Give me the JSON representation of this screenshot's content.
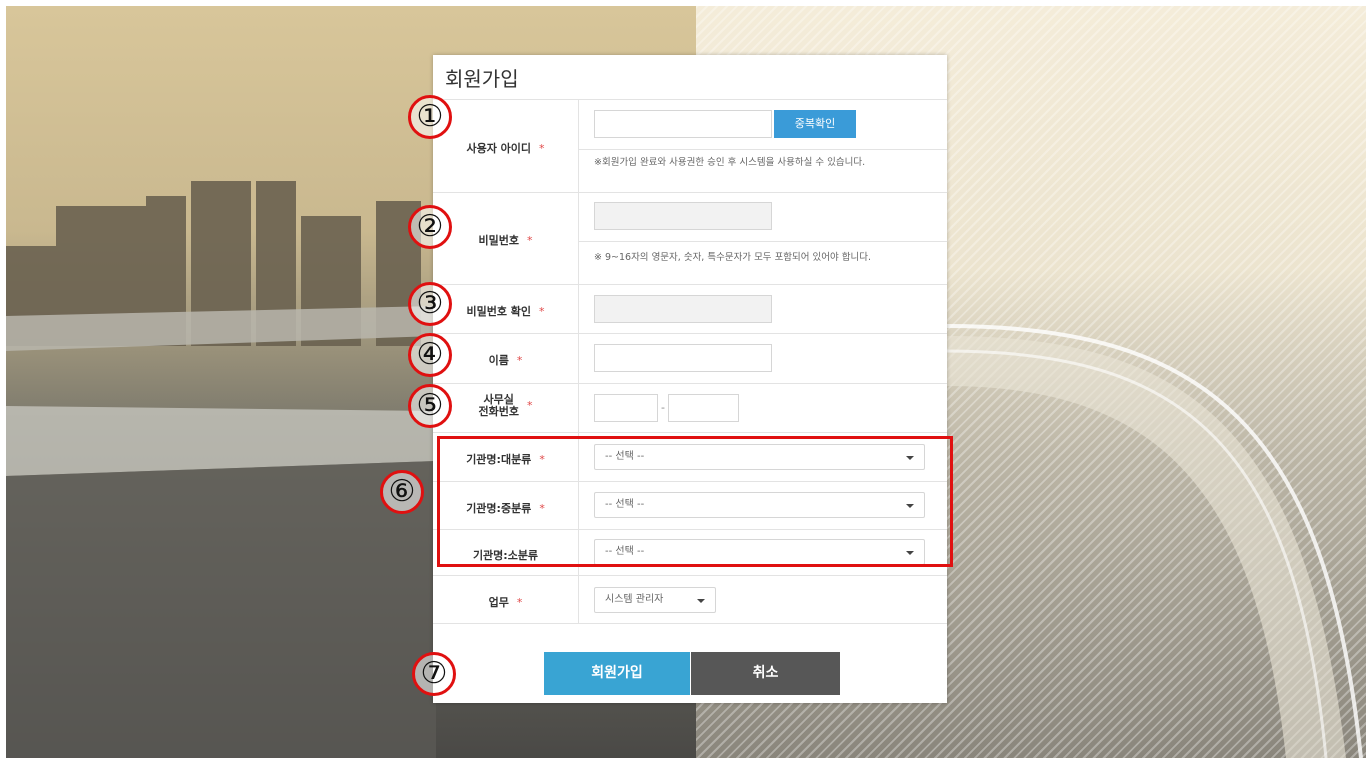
{
  "form": {
    "title": "회원가입",
    "user_id": {
      "label": "사용자 아이디",
      "required": "*",
      "value": "",
      "check_button": "중복확인",
      "hint": "※회원가입 완료와 사용권한 승인 후 시스템을 사용하실 수 있습니다."
    },
    "password": {
      "label": "비밀번호",
      "required": "*",
      "value": "",
      "hint": "※ 9~16자의 영문자, 숫자, 특수문자가 모두 포함되어 있어야 합니다."
    },
    "password_confirm": {
      "label": "비밀번호 확인",
      "required": "*",
      "value": ""
    },
    "name": {
      "label": "이름",
      "required": "*",
      "value": ""
    },
    "office_phone": {
      "label_line1": "사무실",
      "label_line2": "전화번호",
      "required": "*",
      "part1": "",
      "separator": "-",
      "part2": ""
    },
    "org_major": {
      "label": "기관명:대분류",
      "required": "*",
      "selected": "-- 선택 --"
    },
    "org_middle": {
      "label": "기관명:중분류",
      "required": "*",
      "selected": "-- 선택 --"
    },
    "org_minor": {
      "label": "기관명:소분류",
      "selected": "-- 선택 --"
    },
    "duty": {
      "label": "업무",
      "required": "*",
      "selected": "시스템 관리자"
    },
    "submit_button": "회원가입",
    "cancel_button": "취소"
  },
  "annotations": [
    "①",
    "②",
    "③",
    "④",
    "⑤",
    "⑥",
    "⑦"
  ],
  "colors": {
    "primary_button": "#39a4d3",
    "cancel_button": "#575757",
    "required_star": "#e04848",
    "annotation_red": "#e01010"
  }
}
